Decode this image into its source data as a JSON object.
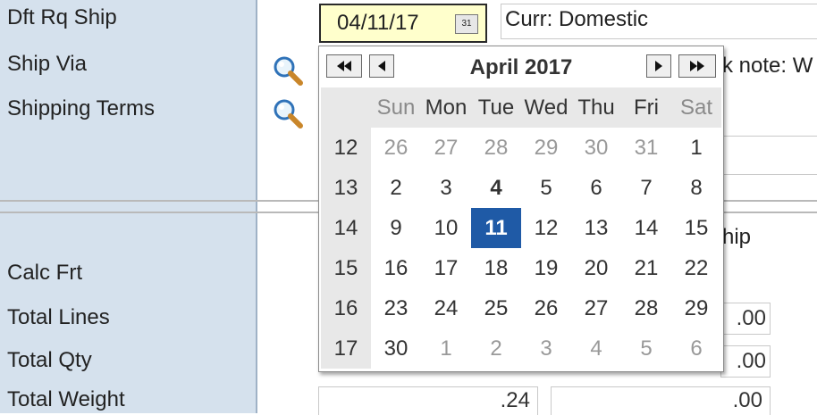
{
  "labels": {
    "dft_rq_ship": "Dft Rq Ship",
    "ship_via": "Ship Via",
    "shipping_terms": "Shipping Terms",
    "calc_frt": "Calc Frt",
    "total_lines": "Total Lines",
    "total_qty": "Total Qty",
    "total_weight": "Total Weight"
  },
  "date_field": {
    "value": "04/11/17",
    "calendar_button": "31"
  },
  "currency_text": "Curr: Domestic",
  "note_text": "k  note: W",
  "ship_text": "hip",
  "totals": {
    "lines_value": ".00",
    "qty_value": ".00",
    "weight_value": ".24",
    "weight_value2": ".00"
  },
  "calendar": {
    "title": "April 2017",
    "day_headers": [
      "Sun",
      "Mon",
      "Tue",
      "Wed",
      "Thu",
      "Fri",
      "Sat"
    ],
    "weeks": [
      {
        "week": "12",
        "days": [
          "26",
          "27",
          "28",
          "29",
          "30",
          "31",
          "1"
        ]
      },
      {
        "week": "13",
        "days": [
          "2",
          "3",
          "4",
          "5",
          "6",
          "7",
          "8"
        ]
      },
      {
        "week": "14",
        "days": [
          "9",
          "10",
          "11",
          "12",
          "13",
          "14",
          "15"
        ]
      },
      {
        "week": "15",
        "days": [
          "16",
          "17",
          "18",
          "19",
          "20",
          "21",
          "22"
        ]
      },
      {
        "week": "16",
        "days": [
          "23",
          "24",
          "25",
          "26",
          "27",
          "28",
          "29"
        ]
      },
      {
        "week": "17",
        "days": [
          "30",
          "1",
          "2",
          "3",
          "4",
          "5",
          "6"
        ]
      }
    ],
    "selected_day": "11",
    "today": "4"
  },
  "colors": {
    "label_panel": "#d5e1ed",
    "date_input_bg": "#ffffcc",
    "selected_bg": "#1f5aa6"
  },
  "icons": {
    "ship_via_lookup": "magnifier-icon",
    "shipping_terms_lookup": "magnifier-icon"
  }
}
